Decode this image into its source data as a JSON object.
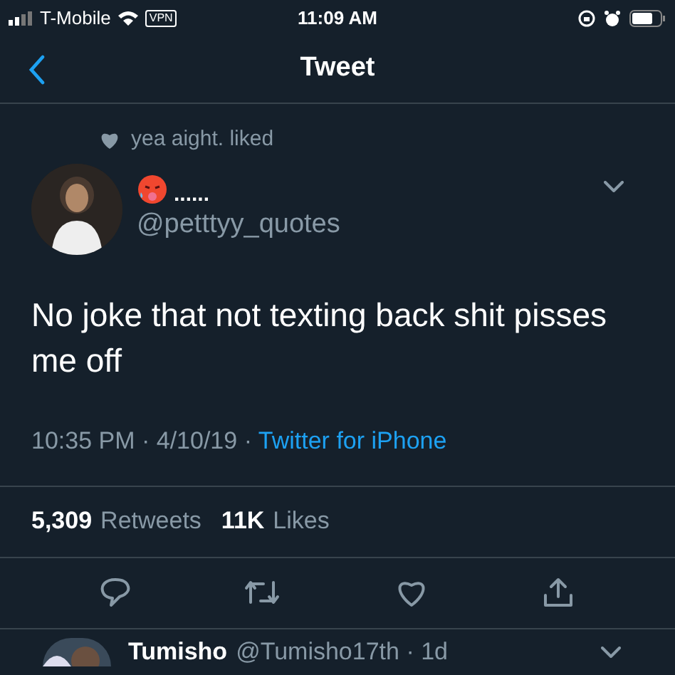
{
  "status_bar": {
    "carrier": "T-Mobile",
    "vpn": "VPN",
    "time": "11:09 AM"
  },
  "nav": {
    "title": "Tweet"
  },
  "social_context": "yea aight. liked",
  "tweet": {
    "name": "......",
    "handle": "@petttyy_quotes",
    "text": "No joke that not texting back shit pisses me off",
    "time": "10:35 PM · 4/10/19 · ",
    "source": "Twitter for iPhone"
  },
  "stats": [
    {
      "count": "5,309",
      "label": "Retweets"
    },
    {
      "count": "11K",
      "label": "Likes"
    }
  ],
  "reply": {
    "name": "Tumisho",
    "handle": "@Tumisho17th · 1d"
  }
}
